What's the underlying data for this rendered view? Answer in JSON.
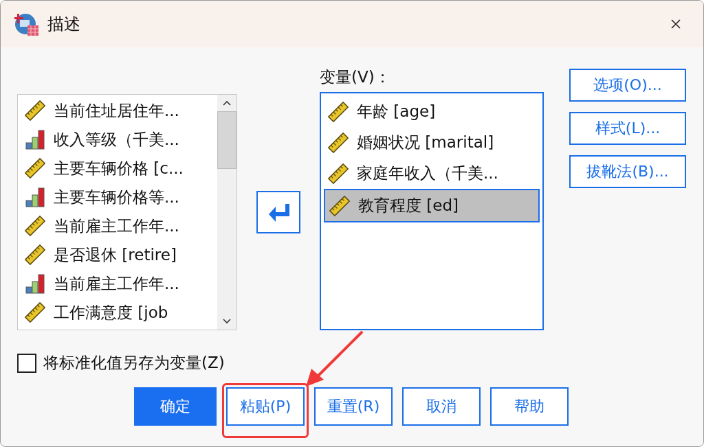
{
  "window": {
    "title": "描述"
  },
  "source_list": {
    "items": [
      {
        "label": "当前住址居住年...",
        "kind": "scale"
      },
      {
        "label": "收入等级（千美...",
        "kind": "ordinal"
      },
      {
        "label": "主要车辆价格 [c...",
        "kind": "scale"
      },
      {
        "label": "主要车辆价格等...",
        "kind": "ordinal"
      },
      {
        "label": "当前雇主工作年...",
        "kind": "scale"
      },
      {
        "label": "是否退休 [retire]",
        "kind": "scale"
      },
      {
        "label": "当前雇主工作年...",
        "kind": "ordinal"
      },
      {
        "label": "工作满意度 [job",
        "kind": "scale"
      }
    ]
  },
  "variables": {
    "label": "变量(V)：",
    "items": [
      {
        "label": "年龄 [age]",
        "kind": "scale",
        "selected": false
      },
      {
        "label": "婚姻状况 [marital]",
        "kind": "scale",
        "selected": false
      },
      {
        "label": "家庭年收入（千美...",
        "kind": "scale",
        "selected": false
      },
      {
        "label": "教育程度 [ed]",
        "kind": "scale",
        "selected": true
      }
    ]
  },
  "side_buttons": [
    "选项(O)...",
    "样式(L)...",
    "拔靴法(B)..."
  ],
  "save_standardized": {
    "label": "将标准化值另存为变量(Z)",
    "checked": false
  },
  "buttons": [
    {
      "label": "确定",
      "kind": "primary"
    },
    {
      "label": "粘贴(P)",
      "kind": "normal"
    },
    {
      "label": "重置(R)",
      "kind": "normal"
    },
    {
      "label": "取消",
      "kind": "normal"
    },
    {
      "label": "帮助",
      "kind": "normal"
    }
  ]
}
